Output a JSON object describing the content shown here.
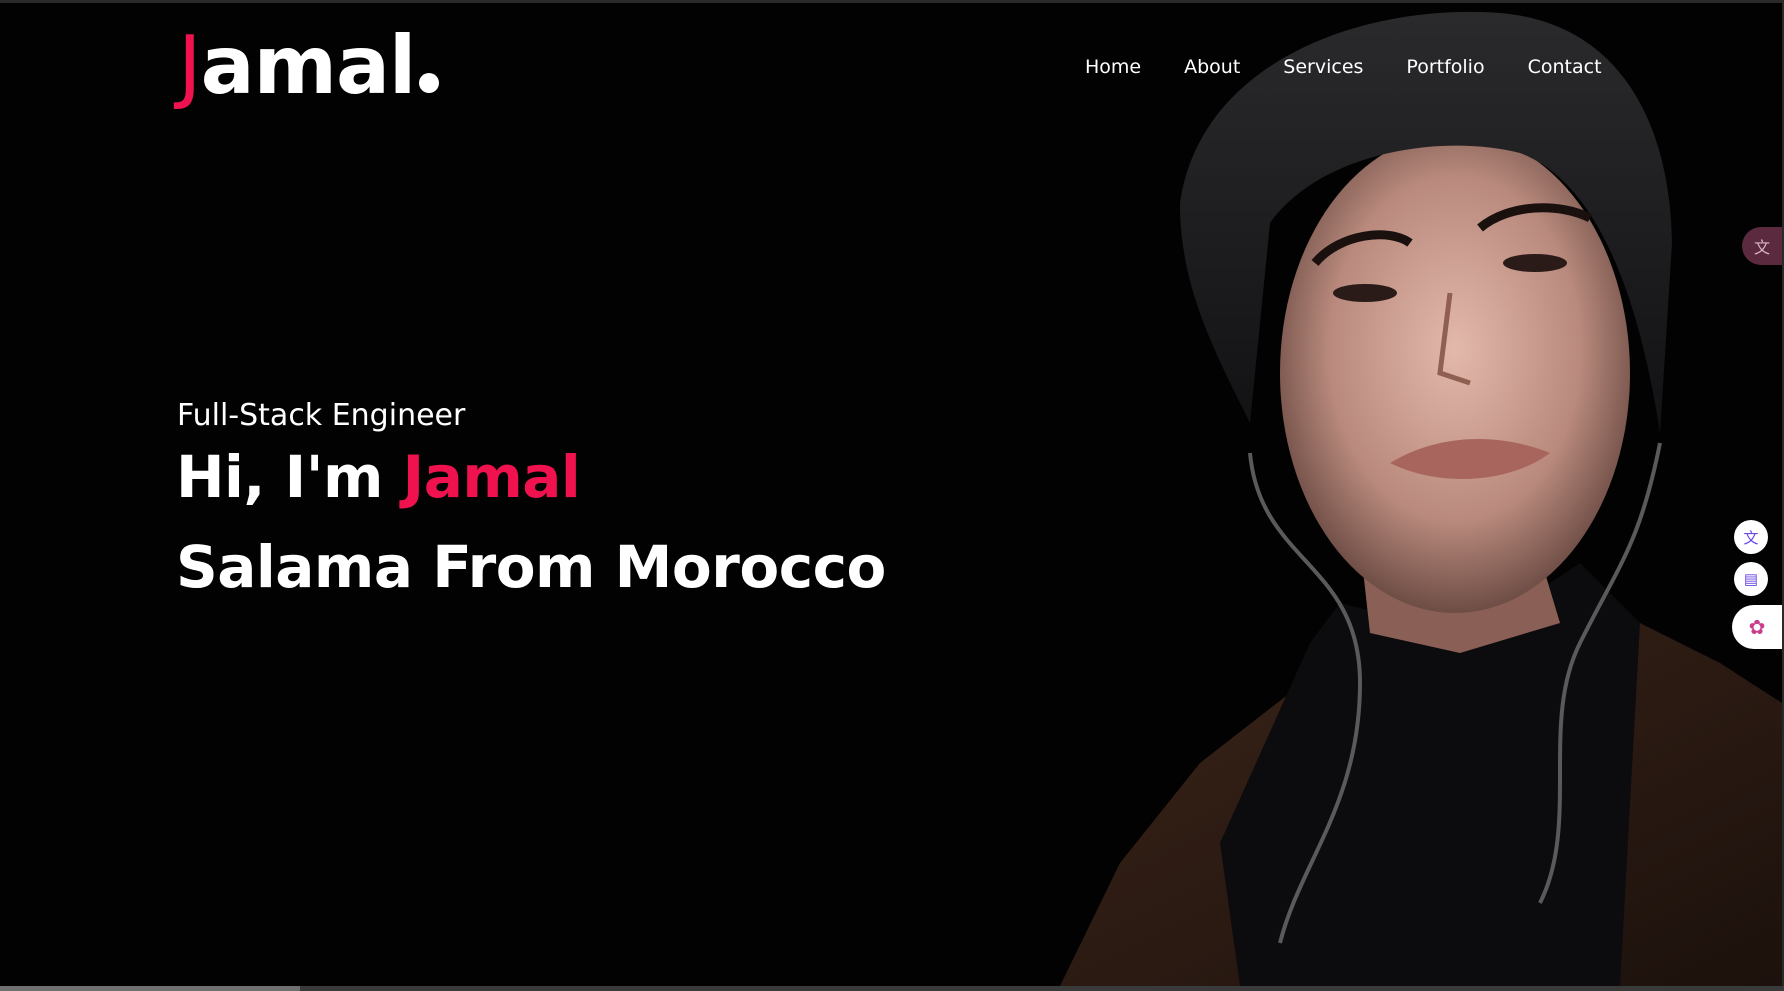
{
  "brand": {
    "logo_initial": "J",
    "logo_rest": "amal",
    "accent_color": "#f0124e"
  },
  "nav": {
    "items": [
      {
        "label": "Home"
      },
      {
        "label": "About"
      },
      {
        "label": "Services"
      },
      {
        "label": "Portfolio"
      },
      {
        "label": "Contact"
      }
    ]
  },
  "hero": {
    "role": "Full-Stack Engineer",
    "greeting": "Hi, I'm",
    "name": "Jamal",
    "tagline": "Salama From Morocco",
    "background_color": "#020202"
  },
  "extensions": {
    "translate_tab_icon": "translate-icon",
    "button1_icon": "translate-icon",
    "button2_icon": "book-icon",
    "pill_icon": "brain-icon"
  }
}
